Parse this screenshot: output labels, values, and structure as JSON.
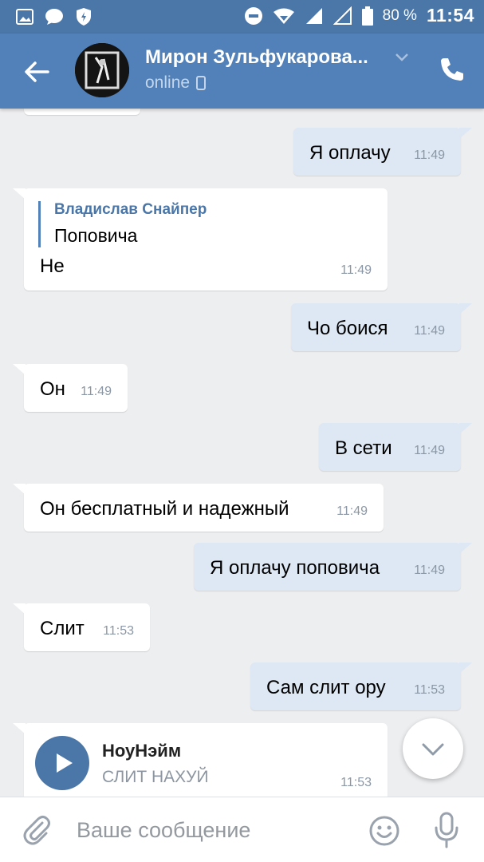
{
  "statusbar": {
    "battery": "80 %",
    "time": "11:54",
    "icons": [
      "image-icon",
      "chat-icon",
      "shield-icon",
      "dnd-icon",
      "wifi-icon",
      "signal-icon",
      "signal-empty-icon",
      "battery-icon"
    ]
  },
  "header": {
    "title": "Мирон Зульфукарова...",
    "status": "online",
    "accent": "#5181b8"
  },
  "messages": [
    {
      "dir": "out",
      "text": "Я оплачу",
      "time": "11:49"
    },
    {
      "dir": "in",
      "reply_author": "Владислав Снайпер",
      "reply_text": "Поповича",
      "text": "Не",
      "time": "11:49"
    },
    {
      "dir": "out",
      "text": "Чо боися",
      "time": "11:49"
    },
    {
      "dir": "in",
      "text": "Он",
      "time": "11:49"
    },
    {
      "dir": "out",
      "text": "В сети",
      "time": "11:49"
    },
    {
      "dir": "in",
      "text": "Он бесплатный и надежный",
      "time": "11:49"
    },
    {
      "dir": "out",
      "text": "Я оплачу поповича",
      "time": "11:49"
    },
    {
      "dir": "in",
      "text": "Слит",
      "time": "11:53"
    },
    {
      "dir": "out",
      "text": "Сам слит ору",
      "time": "11:53"
    },
    {
      "dir": "in",
      "audio_title": "НоуНэйм",
      "audio_subtitle": "СЛИТ НАХУЙ",
      "time": "11:53"
    }
  ],
  "composer": {
    "placeholder": "Ваше сообщение"
  }
}
